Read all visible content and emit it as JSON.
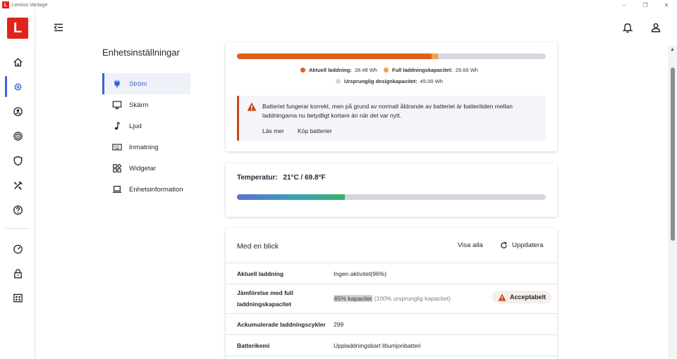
{
  "window": {
    "title": "Lenovo Vantage",
    "logo_letter": "L",
    "controls": {
      "minimize": "–",
      "maximize": "❐",
      "close": "✕"
    }
  },
  "rail": {
    "logo_letter": "L",
    "items": [
      {
        "icon": "home-icon"
      },
      {
        "icon": "settings-gear-icon",
        "active": true
      },
      {
        "icon": "account-icon"
      },
      {
        "icon": "wifi-security-icon"
      },
      {
        "icon": "shield-icon"
      },
      {
        "icon": "tools-icon"
      },
      {
        "icon": "help-icon"
      },
      {
        "icon": "speedometer-icon"
      },
      {
        "icon": "lock-icon"
      },
      {
        "icon": "apps-grid-icon"
      }
    ]
  },
  "page": {
    "title": "Enhetsinställningar"
  },
  "subnav": {
    "items": [
      {
        "label": "Ström",
        "icon": "power-plug-icon",
        "active": true
      },
      {
        "label": "Skärm",
        "icon": "monitor-icon"
      },
      {
        "label": "Ljud",
        "icon": "music-note-icon"
      },
      {
        "label": "Inmatning",
        "icon": "keyboard-icon"
      },
      {
        "label": "Widgetar",
        "icon": "widgets-icon"
      },
      {
        "label": "Enhetsinformation",
        "icon": "laptop-icon"
      }
    ]
  },
  "battery": {
    "current_fraction": 0.63,
    "full_fraction": 0.651,
    "colors": {
      "current": "#e0601a",
      "full": "#f0a050",
      "design": "#d4d8de"
    },
    "legend": {
      "current_label": "Aktuell laddning:",
      "current_value": "28.48 Wh",
      "full_label": "Full laddningskapacitet:",
      "full_value": "29.66 Wh",
      "design_label": "Ursprunglig designkapacitet:",
      "design_value": "45.00 Wh"
    },
    "warning": {
      "text": "Batteriet fungerar korrekt, men på grund av normalt åldrande av batteriet är batteritiden mellan laddningarna nu betydligt kortare än när det var nytt.",
      "link_read_more": "Läs mer",
      "link_buy": "Köp batterier"
    }
  },
  "temperature": {
    "label": "Temperatur:",
    "value": "21°C / 69.8°F",
    "fraction": 0.35,
    "gradient": [
      "#5b6fd6",
      "#3aa0b8",
      "#3bb36a"
    ]
  },
  "glance": {
    "title": "Med en blick",
    "show_all": "Visa alla",
    "refresh": "Uppdatera",
    "rows": [
      {
        "key": "Aktuell laddning",
        "value": "Ingen aktivitet(96%)"
      },
      {
        "key": "Jämförelse med full laddningskapacitet",
        "value_highlight": "65% kapacitet",
        "value_muted": " (100% ursprunglig kapacitet)",
        "badge": "Acceptabelt"
      },
      {
        "key": "Ackumulerade laddningscykler",
        "value": "299"
      },
      {
        "key": "Batterikemi",
        "value": "Uppladdningsbart litiumjonbatteri"
      }
    ]
  }
}
